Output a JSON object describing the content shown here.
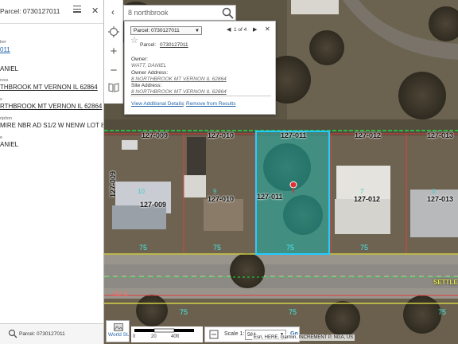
{
  "left_panel": {
    "title": "Parcel: 0730127011",
    "fields": [
      {
        "label": "ber",
        "value": "011",
        "link": true
      },
      {
        "label": "",
        "value": "ANIEL",
        "link": false
      },
      {
        "label": "ress",
        "value": "THBROOK MT VERNON IL 62864",
        "link": false
      },
      {
        "label": "s",
        "value": "RTHBROOK MT VERNON IL 62864",
        "link": false
      },
      {
        "label": "ription",
        "value": "MIRE NBR AD S1/2 W NENW LOT 8",
        "link": false
      },
      {
        "label": "e",
        "value": "ANIEL",
        "link": false
      }
    ],
    "footer_title": "Parcel: 0730127011"
  },
  "search": {
    "value": "8 northbrook"
  },
  "popup": {
    "select_value": "Parcel: 0730127011",
    "count": "1 of 4",
    "parcel_label": "Parcel:",
    "parcel_value": "0730127011",
    "owner_label": "Owner:",
    "owner_value": "WATT, DANIEL",
    "owner_address_label": "Owner Address:",
    "owner_address_value": "8 NORTHBROOK MT VERNON IL 62864",
    "site_address_label": "Site Address:",
    "site_address_value": "8 NORTHBROOK MT VERNON IL 62864",
    "link_details": "View Additional Details",
    "separator": "|",
    "link_remove": "Remove from Results"
  },
  "map": {
    "parcel_labels": [
      "127-009",
      "127-010",
      "127-011",
      "127-012",
      "127-013",
      "127-009",
      "127-010",
      "127-011",
      "127-012",
      "127-013",
      "127-009"
    ],
    "house_numbers": [
      "10",
      "9",
      "7",
      "6"
    ],
    "lot_widths": [
      "75",
      "75",
      "75",
      "75"
    ],
    "bottom_widths": [
      "75",
      "75",
      "75"
    ],
    "street_name": "SETTLE",
    "street_number": "112.5",
    "colors": {
      "selected_fill": "#1fb3a8",
      "selected_stroke": "#22ccff",
      "parcel_line": "#e04040",
      "row_line": "#e8e84a",
      "north_line": "#22dd44"
    }
  },
  "bottom": {
    "basemap_label": "World St...",
    "scale_ticks": [
      "0",
      "20",
      "40ft"
    ],
    "scale_label": "Scale 1:",
    "scale_value": "564",
    "go_label": "Go",
    "attribution": "Esri, HERE, Garmin, INCREMENT P, NGA, US"
  }
}
